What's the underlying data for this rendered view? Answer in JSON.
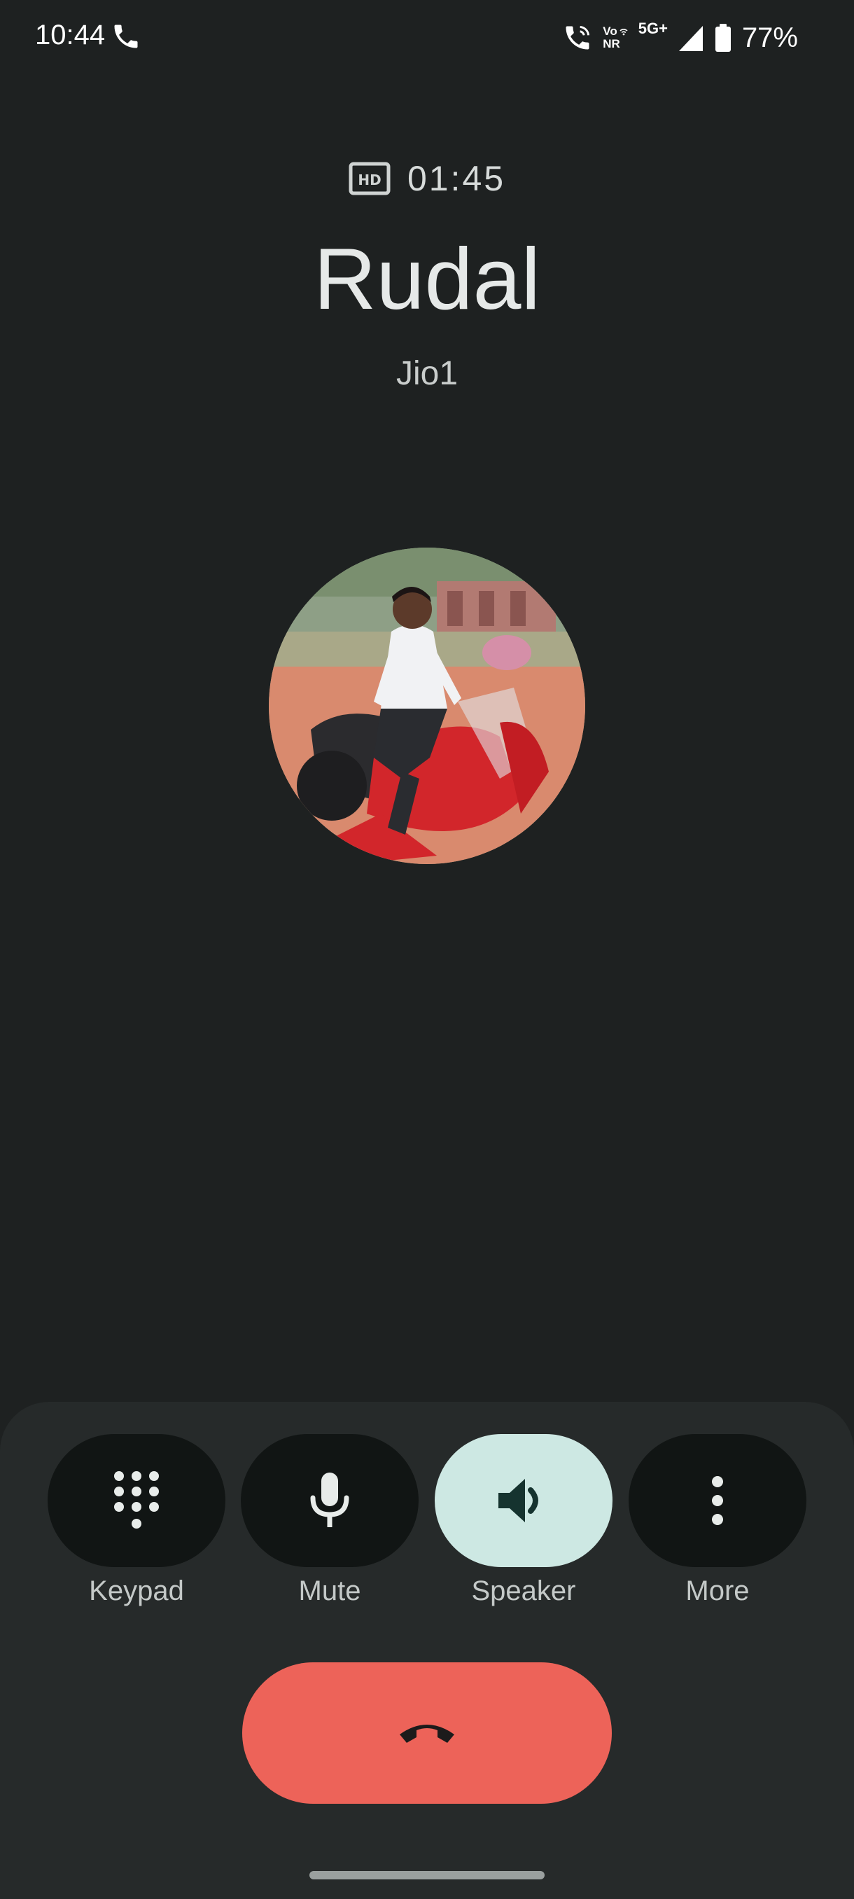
{
  "status_bar": {
    "time": "10:44",
    "volte_top": "Vo",
    "volte_bottom": "NR",
    "network_type": "5G+",
    "battery": "77%"
  },
  "call": {
    "timer": "01:45",
    "caller_name": "Rudal",
    "sim_line": "Jio1",
    "hd_icon": "hd-icon"
  },
  "actions": {
    "keypad_label": "Keypad",
    "mute_label": "Mute",
    "speaker_label": "Speaker",
    "more_label": "More"
  },
  "colors": {
    "background": "#1e2121",
    "panel": "#262a2a",
    "button": "#111514",
    "speaker_active": "#cde8e3",
    "end_call": "#ed6359"
  }
}
